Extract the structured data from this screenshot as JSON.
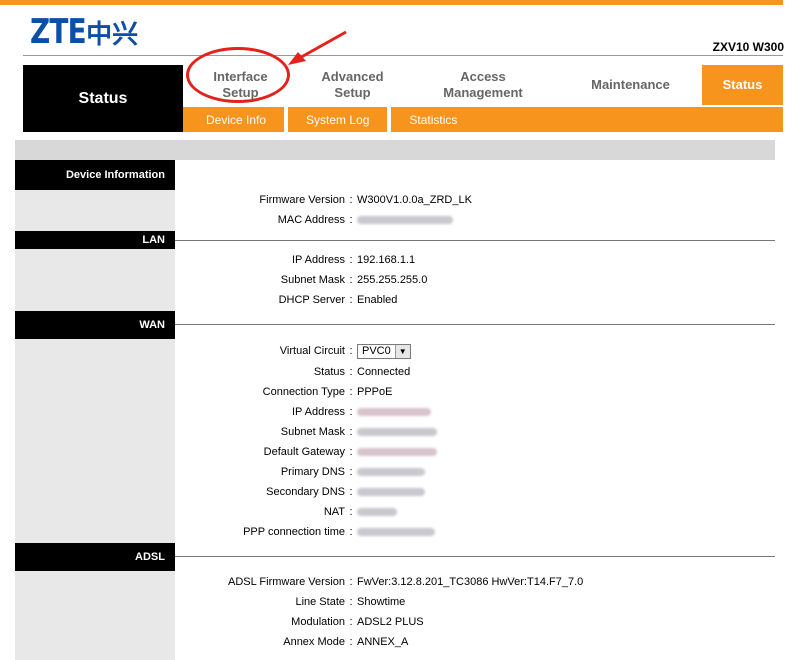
{
  "header": {
    "logo_latin": "ZTE",
    "logo_cn": "中兴",
    "model": "ZXV10 W300"
  },
  "nav": {
    "section_title": "Status",
    "tabs": [
      {
        "label": "Interface\nSetup",
        "active": false
      },
      {
        "label": "Advanced\nSetup",
        "active": false
      },
      {
        "label": "Access\nManagement",
        "active": false
      },
      {
        "label": "Maintenance",
        "active": false
      },
      {
        "label": "Status",
        "active": true
      }
    ],
    "subtabs": [
      "Device Info",
      "System Log",
      "Statistics"
    ]
  },
  "sections": {
    "device": {
      "title": "Device Information",
      "firmware_label": "Firmware Version",
      "firmware_value": "W300V1.0.0a_ZRD_LK",
      "mac_label": "MAC Address"
    },
    "lan": {
      "title": "LAN",
      "ip_label": "IP Address",
      "ip_value": "192.168.1.1",
      "mask_label": "Subnet Mask",
      "mask_value": "255.255.255.0",
      "dhcp_label": "DHCP Server",
      "dhcp_value": "Enabled"
    },
    "wan": {
      "title": "WAN",
      "vc_label": "Virtual Circuit",
      "vc_value": "PVC0",
      "status_label": "Status",
      "status_value": "Connected",
      "conn_label": "Connection Type",
      "conn_value": "PPPoE",
      "ip_label": "IP Address",
      "mask_label": "Subnet Mask",
      "gw_label": "Default Gateway",
      "dns1_label": "Primary DNS",
      "dns2_label": "Secondary DNS",
      "nat_label": "NAT",
      "ppp_label": "PPP connection time"
    },
    "adsl": {
      "title": "ADSL",
      "fw_label": "ADSL Firmware Version",
      "fw_value": "FwVer:3.12.8.201_TC3086 HwVer:T14.F7_7.0",
      "line_label": "Line State",
      "line_value": "Showtime",
      "mod_label": "Modulation",
      "mod_value": "ADSL2 PLUS",
      "annex_label": "Annex Mode",
      "annex_value": "ANNEX_A"
    }
  },
  "colors": {
    "accent": "#f7941d",
    "header_black": "#000000",
    "logo_blue": "#0b4fa6",
    "annotation_red": "#e3221b"
  }
}
